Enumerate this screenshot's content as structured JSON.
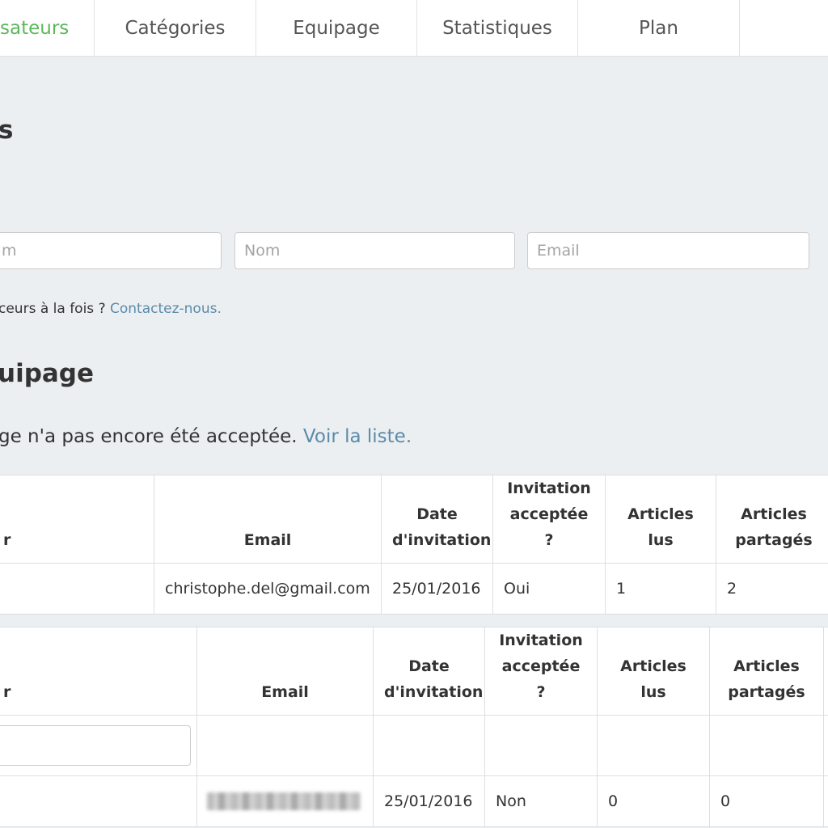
{
  "nav": {
    "tabs": [
      {
        "label": "sateurs",
        "active": true
      },
      {
        "label": "Catégories",
        "active": false
      },
      {
        "label": "Equipage",
        "active": false
      },
      {
        "label": "Statistiques",
        "active": false
      },
      {
        "label": "Plan",
        "active": false
      },
      {
        "label": "",
        "active": false
      }
    ]
  },
  "section1": {
    "heading": "s",
    "inputs": [
      {
        "placeholder": "m"
      },
      {
        "placeholder": "Nom"
      },
      {
        "placeholder": "Email"
      }
    ],
    "help_text": "ceurs à la fois ? ",
    "help_link": "Contactez-nous."
  },
  "section2": {
    "heading": "uipage",
    "notice_text": "ge n'a pas encore été acceptée. ",
    "notice_link": "Voir la liste."
  },
  "table1": {
    "headers": [
      "r",
      "Email",
      "Date d'invitation",
      "Invitation acceptée ?",
      "Articles lus",
      "Articles partagés"
    ],
    "rows": [
      {
        "name": "",
        "email": "christophe.del@gmail.com",
        "date": "25/01/2016",
        "accepted": "Oui",
        "read": "1",
        "shared": "2"
      }
    ]
  },
  "table2": {
    "headers": [
      "r",
      "Email",
      "Date d'invitation",
      "Invitation acceptée ?",
      "Articles lus",
      "Articles partagés"
    ],
    "rows": [
      {
        "name": "",
        "email": "",
        "date": "25/01/2016",
        "accepted": "Non",
        "read": "0",
        "shared": "0"
      }
    ]
  },
  "colors": {
    "accent": "#5cb85c",
    "link": "#5b8ba8",
    "background": "#eceff2"
  }
}
